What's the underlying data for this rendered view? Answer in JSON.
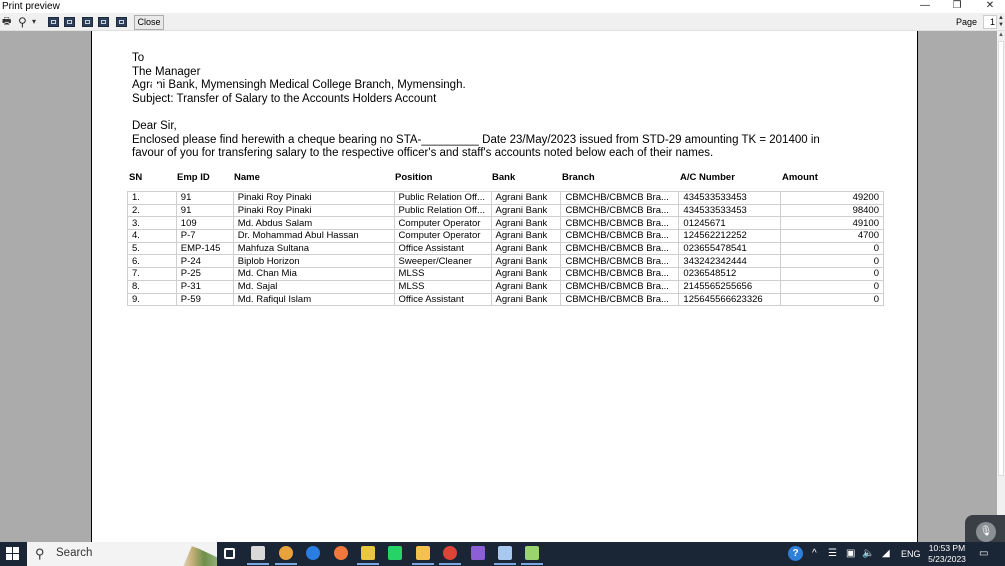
{
  "window": {
    "title": "Print preview",
    "controls": {
      "minimize": "—",
      "restore": "❐",
      "close": "✕"
    }
  },
  "toolbar": {
    "print_icon": "🖶",
    "zoom_icon": "⚲",
    "zoom_dropdown": "▾",
    "layout_buttons": [
      "one-page",
      "two-pages",
      "three-pages",
      "four-pages",
      "six-pages"
    ],
    "close_label": "Close",
    "page_label": "Page",
    "page_value": "1",
    "spin_up": "▲",
    "spin_down": "▼"
  },
  "letter": {
    "to": "To",
    "recipient": "The Manager",
    "bank_line": "Agrani Bank, Mymensingh Medical College Branch, Mymensingh.",
    "subject": "Subject: Transfer of Salary to the Accounts Holders Account",
    "salutation": "Dear Sir,",
    "body_line1": "Enclosed please find herewith a cheque bearing no STA-_________ Date 23/May/2023 issued from STD-29 amounting TK = 201400 in",
    "body_line2": "favour of you for transfering salary to the respective officer's and staff's accounts noted below each of their names."
  },
  "table": {
    "headers": {
      "sn": "SN",
      "emp_id": "Emp ID",
      "name": "Name",
      "position": "Position",
      "bank": "Bank",
      "branch": "Branch",
      "ac_number": "A/C Number",
      "amount": "Amount"
    },
    "rows": [
      {
        "sn": "1.",
        "emp_id": "91",
        "name": "Pinaki Roy Pinaki",
        "position": "Public Relation Off...",
        "bank": "Agrani Bank",
        "branch": "CBMCHB/CBMCB Bra...",
        "ac_number": "434533533453",
        "amount": "49200"
      },
      {
        "sn": "2.",
        "emp_id": "91",
        "name": "Pinaki Roy Pinaki",
        "position": "Public Relation Off...",
        "bank": "Agrani Bank",
        "branch": "CBMCHB/CBMCB Bra...",
        "ac_number": "434533533453",
        "amount": "98400"
      },
      {
        "sn": "3.",
        "emp_id": "109",
        "name": "Md. Abdus Salam",
        "position": "Computer Operator",
        "bank": "Agrani Bank",
        "branch": "CBMCHB/CBMCB Bra...",
        "ac_number": "01245671",
        "amount": "49100"
      },
      {
        "sn": "4.",
        "emp_id": "P-7",
        "name": "Dr. Mohammad Abul Hassan",
        "position": "Computer Operator",
        "bank": "Agrani Bank",
        "branch": "CBMCHB/CBMCB Bra...",
        "ac_number": "124562212252",
        "amount": "4700"
      },
      {
        "sn": "5.",
        "emp_id": "EMP-145",
        "name": "Mahfuza Sultana",
        "position": "Office Assistant",
        "bank": "Agrani Bank",
        "branch": "CBMCHB/CBMCB Bra...",
        "ac_number": "023655478541",
        "amount": "0"
      },
      {
        "sn": "6.",
        "emp_id": "P-24",
        "name": "Biplob Horizon",
        "position": "Sweeper/Cleaner",
        "bank": "Agrani Bank",
        "branch": "CBMCHB/CBMCB Bra...",
        "ac_number": "343242342444",
        "amount": "0"
      },
      {
        "sn": "7.",
        "emp_id": "P-25",
        "name": "Md. Chan Mia",
        "position": "MLSS",
        "bank": "Agrani Bank",
        "branch": "CBMCHB/CBMCB Bra...",
        "ac_number": "0236548512",
        "amount": "0"
      },
      {
        "sn": "8.",
        "emp_id": "P-31",
        "name": "Md. Sajal",
        "position": "MLSS",
        "bank": "Agrani Bank",
        "branch": "CBMCHB/CBMCB Bra...",
        "ac_number": "2145565255656",
        "amount": "0"
      },
      {
        "sn": "9.",
        "emp_id": "P-59",
        "name": "Md. Rafiqul Islam",
        "position": "Office Assistant",
        "bank": "Agrani Bank",
        "branch": "CBMCHB/CBMCB Bra...",
        "ac_number": "125645566623326",
        "amount": "0"
      }
    ]
  },
  "taskbar": {
    "search_placeholder": "Search",
    "apps": [
      {
        "name": "task-view",
        "color": "#ffffff"
      },
      {
        "name": "notepad-app",
        "color": "#d9d9d9"
      },
      {
        "name": "chrome-app",
        "color": "#e8a33d"
      },
      {
        "name": "messenger-app",
        "color": "#2a7de1"
      },
      {
        "name": "browser-app",
        "color": "#f0783c"
      },
      {
        "name": "sticky-app",
        "color": "#e8c840"
      },
      {
        "name": "whatsapp-app",
        "color": "#25d366"
      },
      {
        "name": "file-explorer-app",
        "color": "#f2c14e"
      },
      {
        "name": "chrome-profile-app",
        "color": "#db4437"
      },
      {
        "name": "visual-studio-app",
        "color": "#8c5fd6"
      },
      {
        "name": "docs-app",
        "color": "#a9c8f0"
      },
      {
        "name": "store-app",
        "color": "#9ad46e"
      }
    ],
    "tray": {
      "help_icon": "?",
      "chevron": "^",
      "language": "ENG",
      "time": "10:53 PM",
      "date": "5/23/2023"
    }
  },
  "overlay": {
    "mic_icon": "🎙"
  }
}
